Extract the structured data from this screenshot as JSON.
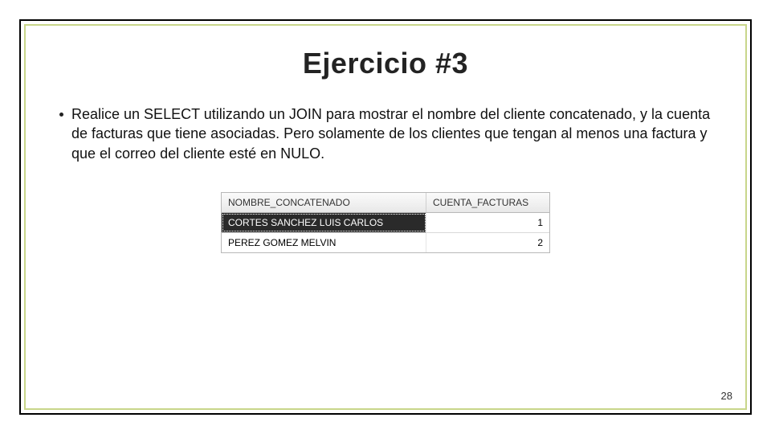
{
  "title": "Ejercicio #3",
  "bullet": "Realice un SELECT utilizando un JOIN para mostrar el nombre del cliente concatenado, y la cuenta de facturas que tiene asociadas. Pero solamente de los clientes que tengan al menos una factura y que el correo del cliente esté en NULO.",
  "table": {
    "headers": {
      "col1": "NOMBRE_CONCATENADO",
      "col2": "CUENTA_FACTURAS"
    },
    "rows": [
      {
        "col1": "CORTES SANCHEZ LUIS CARLOS",
        "col2": "1",
        "selected": true
      },
      {
        "col1": "PEREZ GOMEZ MELVIN",
        "col2": "2",
        "selected": false
      }
    ]
  },
  "page_number": "28"
}
